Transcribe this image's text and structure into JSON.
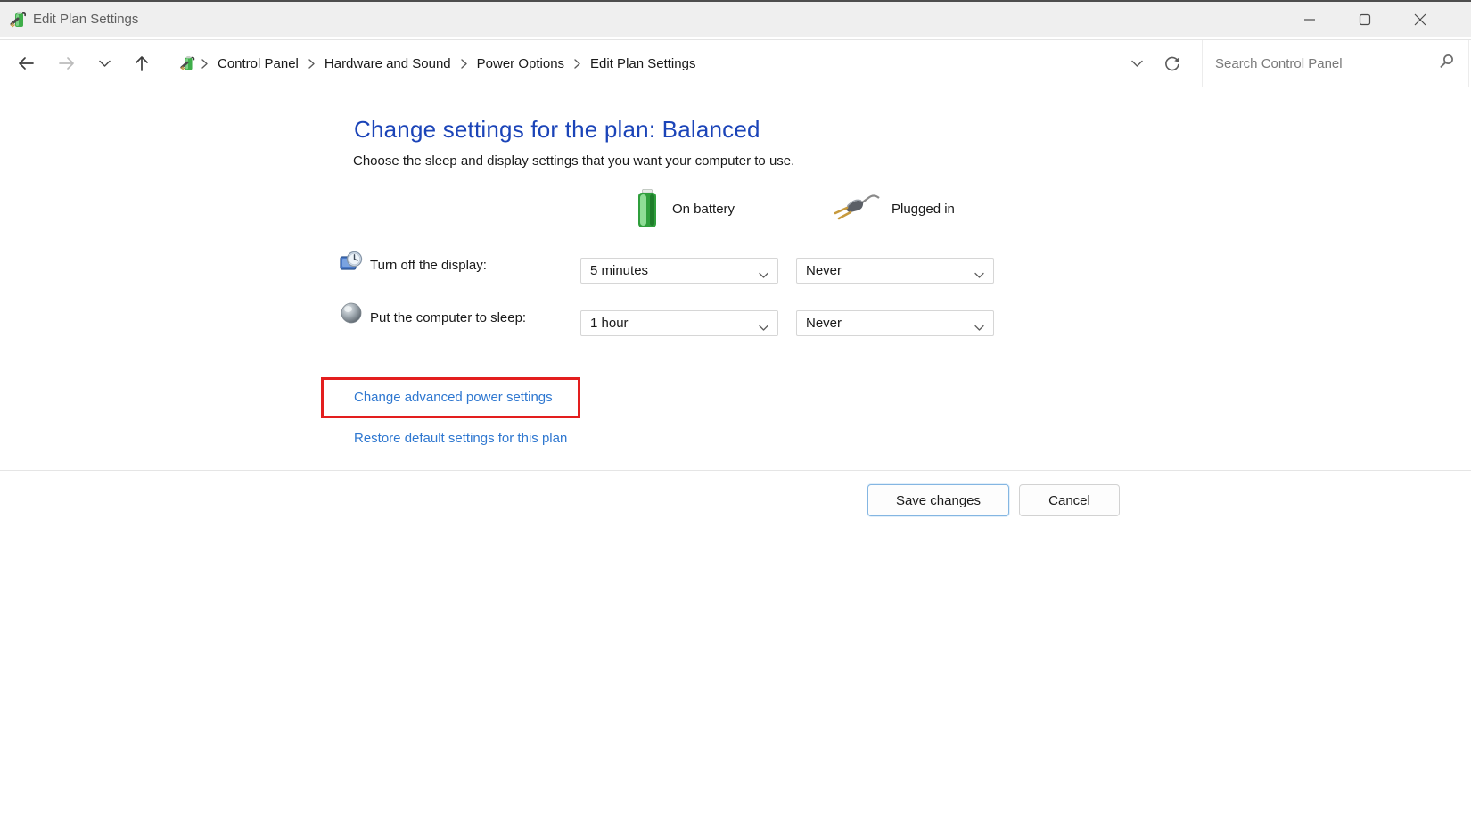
{
  "titlebar": {
    "title": "Edit Plan Settings"
  },
  "navbar": {
    "breadcrumb": {
      "items": [
        "Control Panel",
        "Hardware and Sound",
        "Power Options",
        "Edit Plan Settings"
      ]
    },
    "search_placeholder": "Search Control Panel"
  },
  "content": {
    "heading": "Change settings for the plan: Balanced",
    "description": "Choose the sleep and display settings that you want your computer to use.",
    "columns": {
      "on_battery": "On battery",
      "plugged_in": "Plugged in"
    },
    "rows": [
      {
        "label": "Turn off the display:",
        "on_battery": "5 minutes",
        "plugged_in": "Never"
      },
      {
        "label": "Put the computer to sleep:",
        "on_battery": "1 hour",
        "plugged_in": "Never"
      }
    ],
    "links": {
      "advanced": "Change advanced power settings",
      "restore": "Restore default settings for this plan"
    }
  },
  "footer": {
    "save": "Save changes",
    "cancel": "Cancel"
  },
  "colors": {
    "heading_blue": "#1b44b8",
    "link_blue": "#2e77d0",
    "highlight_red": "#e31e1e",
    "titlebar_bg": "#efefef"
  }
}
